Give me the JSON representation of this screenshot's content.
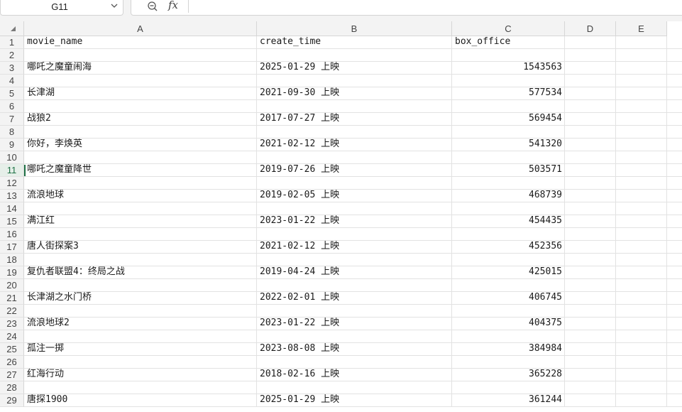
{
  "formula_bar": {
    "cell_ref": "G11",
    "formula_icon": "fx",
    "zoom_icon": "zoom-out-icon"
  },
  "columns": [
    "A",
    "B",
    "C",
    "D",
    "E"
  ],
  "active_row": 11,
  "rows": [
    {
      "n": "1",
      "a": "movie_name",
      "b": "create_time",
      "c": "box_office",
      "num": false
    },
    {
      "n": "2",
      "a": "",
      "b": "",
      "c": ""
    },
    {
      "n": "3",
      "a": "哪吒之魔童闹海",
      "b": "2025-01-29 上映",
      "c": "1543563",
      "num": true
    },
    {
      "n": "4",
      "a": "",
      "b": "",
      "c": ""
    },
    {
      "n": "5",
      "a": "长津湖",
      "b": "2021-09-30 上映",
      "c": "577534",
      "num": true
    },
    {
      "n": "6",
      "a": "",
      "b": "",
      "c": ""
    },
    {
      "n": "7",
      "a": "战狼2",
      "b": "2017-07-27 上映",
      "c": "569454",
      "num": true
    },
    {
      "n": "8",
      "a": "",
      "b": "",
      "c": ""
    },
    {
      "n": "9",
      "a": "你好，李焕英",
      "b": "2021-02-12 上映",
      "c": "541320",
      "num": true
    },
    {
      "n": "10",
      "a": "",
      "b": "",
      "c": ""
    },
    {
      "n": "11",
      "a": "哪吒之魔童降世",
      "b": "2019-07-26 上映",
      "c": "503571",
      "num": true
    },
    {
      "n": "12",
      "a": "",
      "b": "",
      "c": ""
    },
    {
      "n": "13",
      "a": "流浪地球",
      "b": "2019-02-05 上映",
      "c": "468739",
      "num": true
    },
    {
      "n": "14",
      "a": "",
      "b": "",
      "c": ""
    },
    {
      "n": "15",
      "a": "满江红",
      "b": "2023-01-22 上映",
      "c": "454435",
      "num": true
    },
    {
      "n": "16",
      "a": "",
      "b": "",
      "c": ""
    },
    {
      "n": "17",
      "a": "唐人街探案3",
      "b": "2021-02-12 上映",
      "c": "452356",
      "num": true
    },
    {
      "n": "18",
      "a": "",
      "b": "",
      "c": ""
    },
    {
      "n": "19",
      "a": "复仇者联盟4：终局之战",
      "b": "2019-04-24 上映",
      "c": "425015",
      "num": true
    },
    {
      "n": "20",
      "a": "",
      "b": "",
      "c": ""
    },
    {
      "n": "21",
      "a": "长津湖之水门桥",
      "b": "2022-02-01 上映",
      "c": "406745",
      "num": true
    },
    {
      "n": "22",
      "a": "",
      "b": "",
      "c": ""
    },
    {
      "n": "23",
      "a": "流浪地球2",
      "b": "2023-01-22 上映",
      "c": "404375",
      "num": true
    },
    {
      "n": "24",
      "a": "",
      "b": "",
      "c": ""
    },
    {
      "n": "25",
      "a": "孤注一掷",
      "b": "2023-08-08 上映",
      "c": "384984",
      "num": true
    },
    {
      "n": "26",
      "a": "",
      "b": "",
      "c": ""
    },
    {
      "n": "27",
      "a": "红海行动",
      "b": "2018-02-16 上映",
      "c": "365228",
      "num": true
    },
    {
      "n": "28",
      "a": "",
      "b": "",
      "c": ""
    },
    {
      "n": "29",
      "a": "唐探1900",
      "b": "2025-01-29 上映",
      "c": "361244",
      "num": true
    }
  ]
}
